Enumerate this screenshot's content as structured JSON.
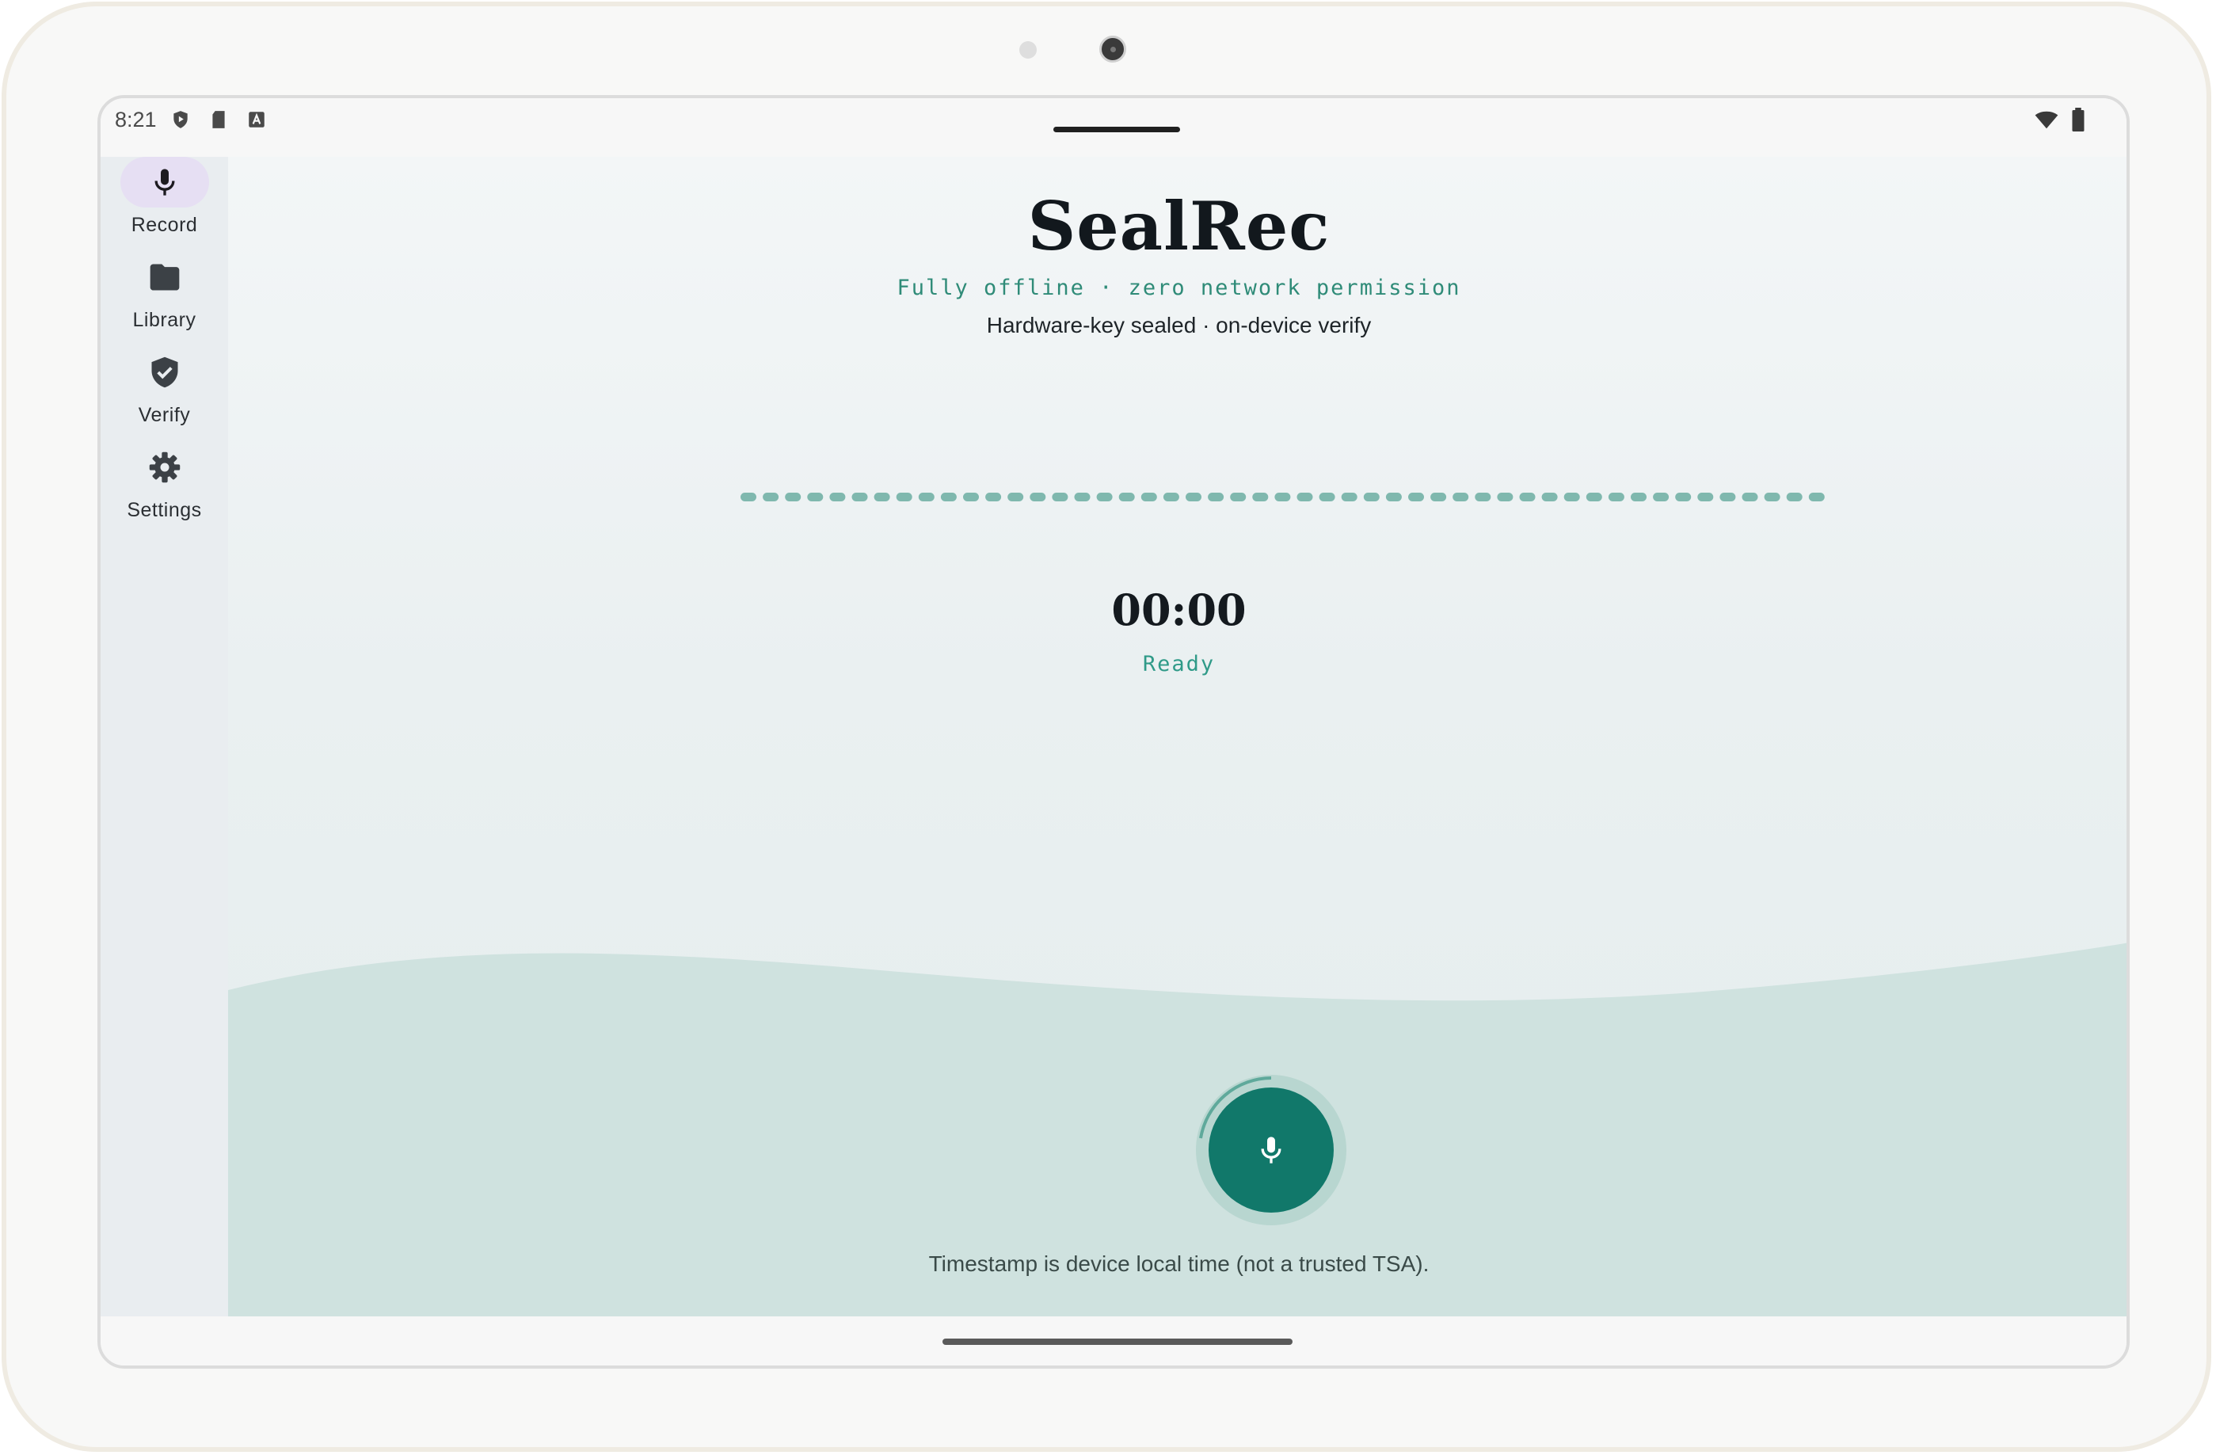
{
  "status_bar": {
    "time": "8:21"
  },
  "nav_rail": {
    "items": [
      {
        "label": "Record",
        "icon": "mic-icon",
        "active": true
      },
      {
        "label": "Library",
        "icon": "folder-icon",
        "active": false
      },
      {
        "label": "Verify",
        "icon": "shield-check-icon",
        "active": false
      },
      {
        "label": "Settings",
        "icon": "gear-icon",
        "active": false
      }
    ]
  },
  "main": {
    "title": "SealRec",
    "subtitle": "Fully offline · zero network permission",
    "tagline": "Hardware-key sealed · on-device verify",
    "timer": "00:00",
    "status": "Ready",
    "record_button_icon": "mic-icon",
    "disclaimer": "Timestamp is device local time (not a trusted TSA)."
  },
  "colors": {
    "accent": "#11786a",
    "accent_light": "#2f9a88",
    "level_dots": "#7fb8ae",
    "rail_active": "#e6dff3"
  }
}
